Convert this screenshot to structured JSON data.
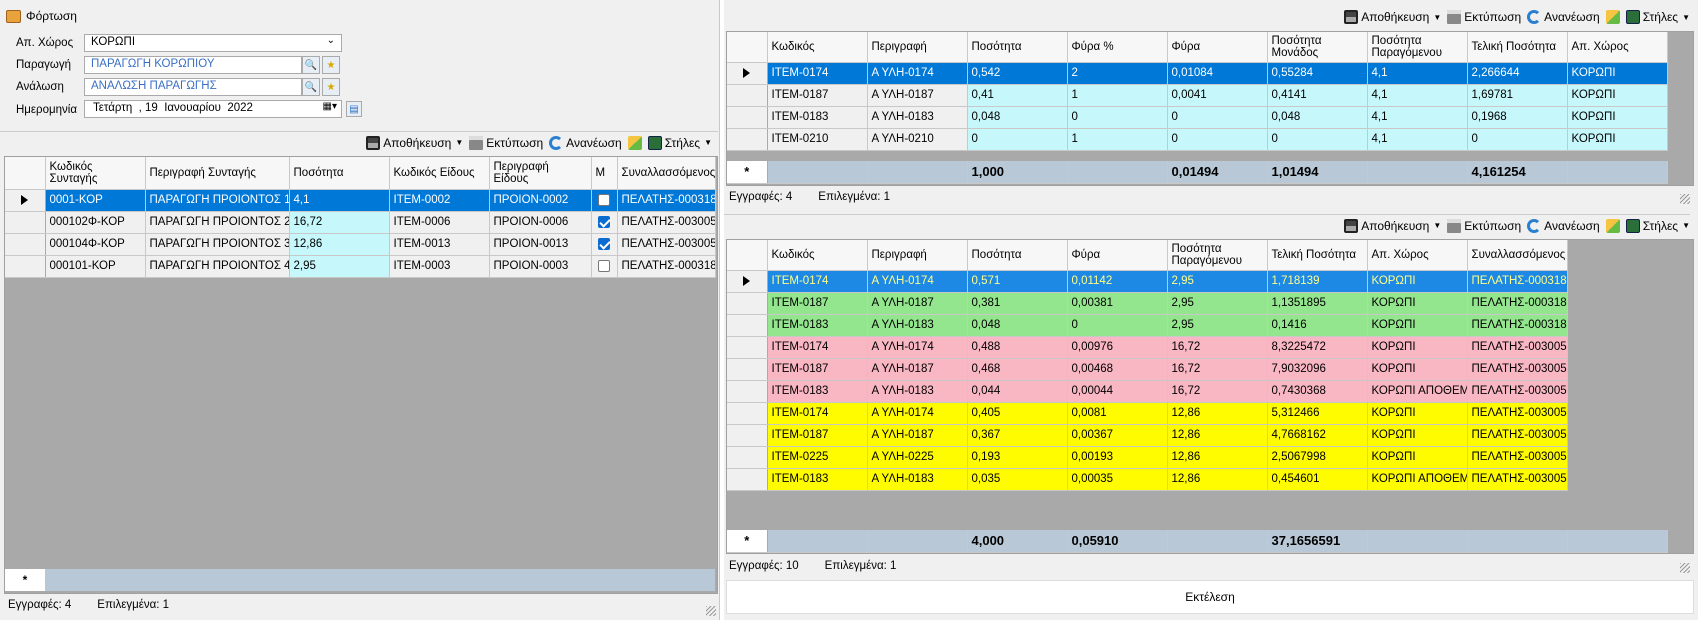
{
  "window": {
    "title": "Φόρτωση"
  },
  "form": {
    "warehouse_label": "Απ. Χώρος",
    "warehouse_value": "ΚΟΡΩΠΙ",
    "production_label": "Παραγωγή",
    "production_value": "ΠΑΡΑΓΩΓΗ ΚΟΡΩΠΙΟΥ",
    "consumption_label": "Ανάλωση",
    "consumption_value": "ΑΝΑΛΩΣΗ ΠΑΡΑΓΩΓΗΣ",
    "date_label": "Ημερομηνία",
    "date_day": "Τετάρτη",
    "date_num": "19",
    "date_month": "Ιανουαρίου",
    "date_year": "2022"
  },
  "toolbar": {
    "save": "Αποθήκευση",
    "print": "Εκτύπωση",
    "refresh": "Ανανέωση",
    "columns": "Στήλες"
  },
  "left_grid": {
    "headers": [
      "Κωδικός Συνταγής",
      "Περιγραφή Συνταγής",
      "Ποσότητα",
      "Κωδικός Είδους",
      "Περιγραφή Είδους",
      "Μ",
      "Συναλλασσόμενος"
    ],
    "rows": [
      [
        "0001-ΚΟΡ",
        "ΠΑΡΑΓΩΓΗ ΠΡΟΙΟΝΤΟΣ 1",
        "4,1",
        "ITEM-0002",
        "ΠΡΟΙΟΝ-0002",
        false,
        "ΠΕΛΑΤΗΣ-000318"
      ],
      [
        "000102Φ-ΚΟΡ",
        "ΠΑΡΑΓΩΓΗ ΠΡΟΙΟΝΤΟΣ 2",
        "16,72",
        "ITEM-0006",
        "ΠΡΟΙΟΝ-0006",
        true,
        "ΠΕΛΑΤΗΣ-003005"
      ],
      [
        "000104Φ-ΚΟΡ",
        "ΠΑΡΑΓΩΓΗ ΠΡΟΙΟΝΤΟΣ 3",
        "12,86",
        "ITEM-0013",
        "ΠΡΟΙΟΝ-0013",
        true,
        "ΠΕΛΑΤΗΣ-003005"
      ],
      [
        "000101-ΚΟΡ",
        "ΠΑΡΑΓΩΓΗ ΠΡΟΙΟΝΤΟΣ 4",
        "2,95",
        "ITEM-0003",
        "ΠΡΟΙΟΝ-0003",
        false,
        "ΠΕΛΑΤΗΣ-000318"
      ]
    ],
    "status": {
      "records": "Εγγραφές: 4",
      "selected": "Επιλεγμένα: 1"
    }
  },
  "top_grid": {
    "headers": [
      "Κωδικός",
      "Περιγραφή",
      "Ποσότητα",
      "Φύρα %",
      "Φύρα",
      "Ποσότητα Μονάδος",
      "Ποσότητα Παραγόμενου",
      "Τελική Ποσότητα",
      "Απ. Χώρος"
    ],
    "rows": [
      [
        "ITEM-0174",
        "Α ΥΛΗ-0174",
        "0,542",
        "2",
        "0,01084",
        "0,55284",
        "4,1",
        "2,266644",
        "ΚΟΡΩΠΙ"
      ],
      [
        "ITEM-0187",
        "Α ΥΛΗ-0187",
        "0,41",
        "1",
        "0,0041",
        "0,4141",
        "4,1",
        "1,69781",
        "ΚΟΡΩΠΙ"
      ],
      [
        "ITEM-0183",
        "Α ΥΛΗ-0183",
        "0,048",
        "0",
        "0",
        "0,048",
        "4,1",
        "0,1968",
        "ΚΟΡΩΠΙ"
      ],
      [
        "ITEM-0210",
        "Α ΥΛΗ-0210",
        "0",
        "1",
        "0",
        "0",
        "4,1",
        "0",
        "ΚΟΡΩΠΙ"
      ]
    ],
    "totals": {
      "qty": "1,000",
      "waste": "0,01494",
      "unit": "1,01494",
      "final": "4,161254"
    },
    "status": {
      "records": "Εγγραφές: 4",
      "selected": "Επιλεγμένα: 1"
    }
  },
  "bottom_grid": {
    "headers": [
      "Κωδικός",
      "Περιγραφή",
      "Ποσότητα",
      "Φύρα",
      "Ποσότητα Παραγόμενου",
      "Τελική Ποσότητα",
      "Απ. Χώρος",
      "Συναλλασσόμενος"
    ],
    "rows": [
      [
        "ITEM-0174",
        "Α ΥΛΗ-0174",
        "0,571",
        "0,01142",
        "2,95",
        "1,718139",
        "ΚΟΡΩΠΙ",
        "ΠΕΛΑΤΗΣ-000318"
      ],
      [
        "ITEM-0187",
        "Α ΥΛΗ-0187",
        "0,381",
        "0,00381",
        "2,95",
        "1,1351895",
        "ΚΟΡΩΠΙ",
        "ΠΕΛΑΤΗΣ-000318"
      ],
      [
        "ITEM-0183",
        "Α ΥΛΗ-0183",
        "0,048",
        "0",
        "2,95",
        "0,1416",
        "ΚΟΡΩΠΙ",
        "ΠΕΛΑΤΗΣ-000318"
      ],
      [
        "ITEM-0174",
        "Α ΥΛΗ-0174",
        "0,488",
        "0,00976",
        "16,72",
        "8,3225472",
        "ΚΟΡΩΠΙ",
        "ΠΕΛΑΤΗΣ-003005"
      ],
      [
        "ITEM-0187",
        "Α ΥΛΗ-0187",
        "0,468",
        "0,00468",
        "16,72",
        "7,9032096",
        "ΚΟΡΩΠΙ",
        "ΠΕΛΑΤΗΣ-003005"
      ],
      [
        "ITEM-0183",
        "Α ΥΛΗ-0183",
        "0,044",
        "0,00044",
        "16,72",
        "0,7430368",
        "ΚΟΡΩΠΙ ΑΠΟΘΕΜ...",
        "ΠΕΛΑΤΗΣ-003005"
      ],
      [
        "ITEM-0174",
        "Α ΥΛΗ-0174",
        "0,405",
        "0,0081",
        "12,86",
        "5,312466",
        "ΚΟΡΩΠΙ",
        "ΠΕΛΑΤΗΣ-003005"
      ],
      [
        "ITEM-0187",
        "Α ΥΛΗ-0187",
        "0,367",
        "0,00367",
        "12,86",
        "4,7668162",
        "ΚΟΡΩΠΙ",
        "ΠΕΛΑΤΗΣ-003005"
      ],
      [
        "ITEM-0225",
        "Α ΥΛΗ-0225",
        "0,193",
        "0,00193",
        "12,86",
        "2,5067998",
        "ΚΟΡΩΠΙ",
        "ΠΕΛΑΤΗΣ-003005"
      ],
      [
        "ITEM-0183",
        "Α ΥΛΗ-0183",
        "0,035",
        "0,00035",
        "12,86",
        "0,454601",
        "ΚΟΡΩΠΙ ΑΠΟΘΕΜ...",
        "ΠΕΛΑΤΗΣ-003005"
      ]
    ],
    "row_colors": [
      "sel",
      "green",
      "green",
      "pink",
      "pink",
      "pink",
      "yellow",
      "yellow",
      "yellow",
      "yellow"
    ],
    "totals": {
      "qty": "4,000",
      "waste": "0,05910",
      "final": "37,1656591"
    },
    "status": {
      "records": "Εγγραφές: 10",
      "selected": "Επιλεγμένα: 1"
    }
  },
  "execute_label": "Εκτέλεση",
  "new_row_marker": "*"
}
